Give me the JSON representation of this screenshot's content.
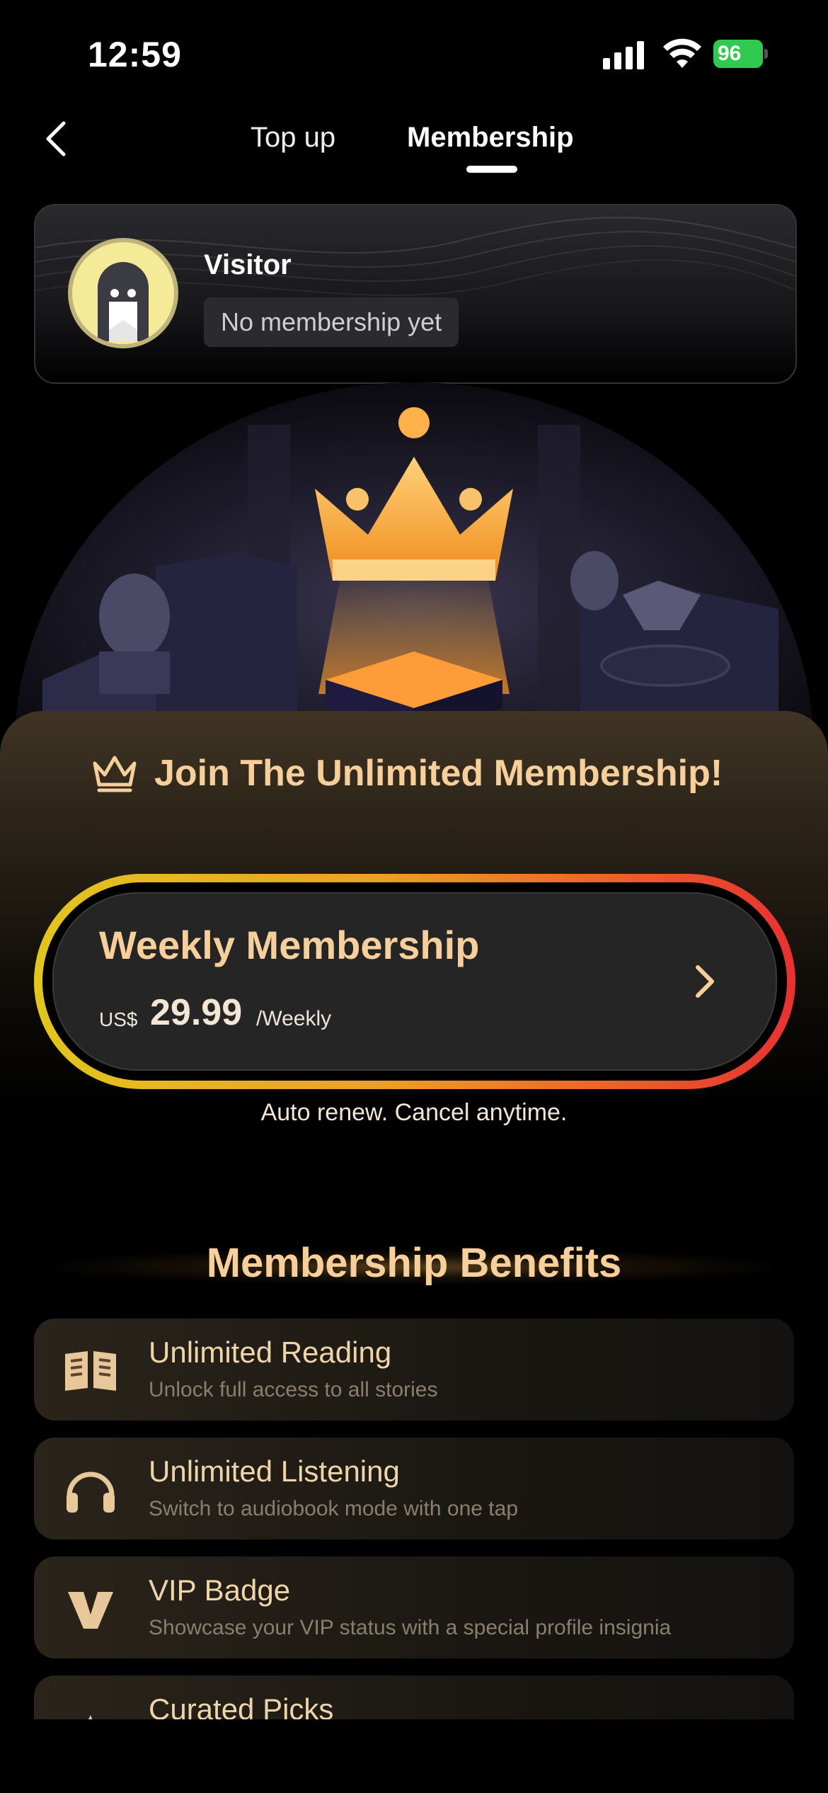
{
  "status_bar": {
    "time": "12:59",
    "battery": "96"
  },
  "nav": {
    "tabs": [
      {
        "label": "Top up",
        "active": false
      },
      {
        "label": "Membership",
        "active": true
      }
    ]
  },
  "profile": {
    "name": "Visitor",
    "status": "No membership yet"
  },
  "join": {
    "title": "Join The Unlimited Membership!"
  },
  "plan": {
    "name": "Weekly Membership",
    "currency": "US$",
    "price": "29.99",
    "period": "/Weekly",
    "note": "Auto renew. Cancel anytime."
  },
  "benefits": {
    "title": "Membership Benefits",
    "items": [
      {
        "title": "Unlimited Reading",
        "desc": "Unlock full access to all stories",
        "icon": "book-icon"
      },
      {
        "title": "Unlimited Listening",
        "desc": "Switch to audiobook mode with one tap",
        "icon": "headphones-icon"
      },
      {
        "title": "VIP Badge",
        "desc": "Showcase your VIP status with a special profile insignia",
        "icon": "vip-badge-icon"
      },
      {
        "title": "Curated Picks",
        "desc": "",
        "icon": "picks-icon"
      }
    ]
  },
  "colors": {
    "accent_gold": "#f7cf9a",
    "gradient_start": "#e3c51c",
    "gradient_end": "#e73131",
    "battery_green": "#2fca4f"
  }
}
